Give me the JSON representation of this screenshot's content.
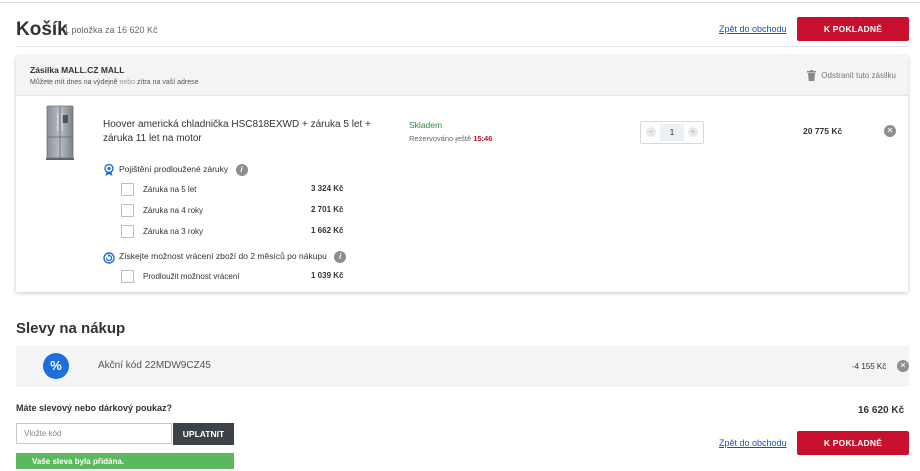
{
  "header": {
    "title": "Košík",
    "subtitle": "1 položka za 16 620 Kč",
    "back_link": "Zpět do obchodu",
    "checkout_button": "K POKLADNĚ"
  },
  "shipment": {
    "title": "Zásilka MALL.CZ MALL",
    "subtitle_a": "Můžete mít dnes na výdejně ",
    "subtitle_or": "nebo",
    "subtitle_b": " zítra na vaší adrese",
    "remove_label": "Odstranit tuto zásilku"
  },
  "product": {
    "name": "Hoover americká chladnička HSC818EXWD + záruka 5 let + záruka 11 let na motor",
    "stock": "Skladem",
    "reserved_label": "Rezervováno ještě",
    "reserved_time": "15:46",
    "quantity": "1",
    "price": "20 775 Kč"
  },
  "insurance": {
    "title": "Pojištění prodloužené záruky",
    "options": [
      {
        "label": "Záruka na 5 let",
        "price": "3 324 Kč"
      },
      {
        "label": "Záruka na 4 roky",
        "price": "2 701 Kč"
      },
      {
        "label": "Záruka na 3 roky",
        "price": "1 662 Kč"
      }
    ]
  },
  "returns": {
    "title": "Získejte možnost vrácení zboží do 2 měsíců po nákupu",
    "options": [
      {
        "label": "Prodloužit možnost vrácení",
        "price": "1 039 Kč"
      }
    ]
  },
  "discounts": {
    "title": "Slevy na nákup",
    "icon": "%",
    "code_text": "Akční kód 22MDW9CZ45",
    "value": "-4 155 Kč"
  },
  "voucher": {
    "title": "Máte slevový nebo dárkový poukaz?",
    "placeholder": "Vložte kód",
    "apply_button": "UPLATNIT",
    "success_message": "Vaše sleva byla přidána."
  },
  "summary": {
    "total": "16 620 Kč",
    "back_link": "Zpět do obchodu",
    "checkout_button": "K POKLADNĚ"
  },
  "colors": {
    "accent": "#c8102e",
    "link": "#1c52b3",
    "stock": "#2a8a3a",
    "discount_icon": "#1e6fd9",
    "success": "#5cb85c"
  }
}
